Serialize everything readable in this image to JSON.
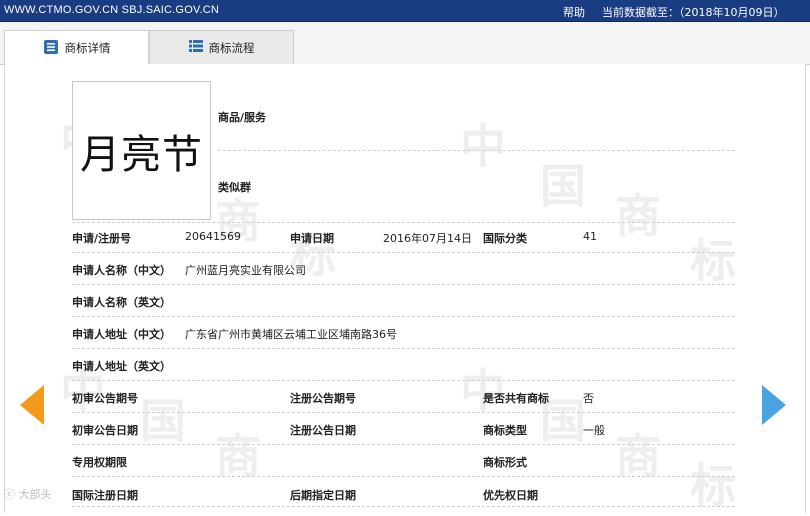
{
  "topbar": {
    "site": "WWW.CTMO.GOV.CN SBJ.SAIC.GOV.CN",
    "help": "帮助",
    "date": "当前数据截至：（2018年10月09日）"
  },
  "tabs": [
    {
      "label": "商标详情",
      "icon": "document-icon"
    },
    {
      "label": "商标流程",
      "icon": "list-icon"
    }
  ],
  "mark": {
    "image_text": "月亮节"
  },
  "goods_label": "商品/服务",
  "similar_label": "类似群",
  "rows": {
    "reg_no_label": "申请/注册号",
    "reg_no": "20641569",
    "app_date_label": "申请日期",
    "app_date": "2016年07月14日",
    "intl_class_label": "国际分类",
    "intl_class": "41",
    "applicant_cn_label": "申请人名称（中文）",
    "applicant_cn": "广州蓝月亮实业有限公司",
    "applicant_en_label": "申请人名称（英文）",
    "address_cn_label": "申请人地址（中文）",
    "address_cn": "广东省广州市黄埔区云埔工业区埔南路36号",
    "address_en_label": "申请人地址（英文）",
    "prelim_no_label": "初审公告期号",
    "reg_pub_no_label": "注册公告期号",
    "shared_label": "是否共有商标",
    "shared": "否",
    "prelim_date_label": "初审公告日期",
    "reg_pub_date_label": "注册公告日期",
    "mark_type_label": "商标类型",
    "mark_type": "一般",
    "exclusive_label": "专用权期限",
    "mark_form_label": "商标形式",
    "intl_reg_date_label": "国际注册日期",
    "later_date_label": "后期指定日期",
    "priority_date_label": "优先权日期"
  },
  "watermark": {
    "char1": "中",
    "char2": "国",
    "char3": "商",
    "char4": "标",
    "source": "大部头"
  },
  "colors": {
    "topbar": "#1a3c82",
    "arrow_left": "#f39a1e",
    "arrow_right": "#4aa3e0"
  }
}
